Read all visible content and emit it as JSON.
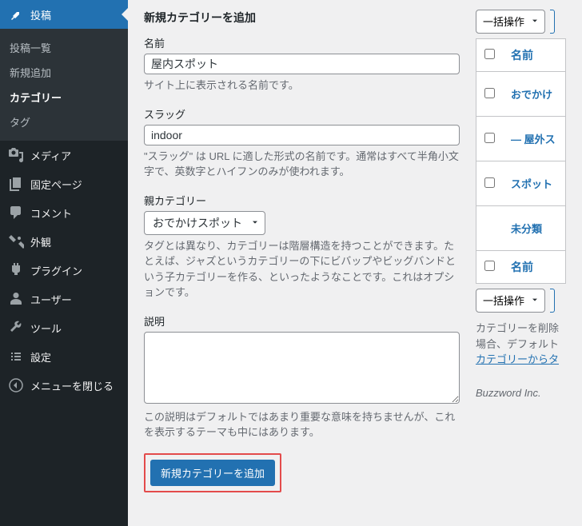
{
  "sidebar": {
    "posts": {
      "label": "投稿"
    },
    "submenu": {
      "all": "投稿一覧",
      "new": "新規追加",
      "category": "カテゴリー",
      "tag": "タグ"
    },
    "media": "メディア",
    "pages": "固定ページ",
    "comments": "コメント",
    "appearance": "外観",
    "plugins": "プラグイン",
    "users": "ユーザー",
    "tools": "ツール",
    "settings": "設定",
    "collapse": "メニューを閉じる"
  },
  "form": {
    "heading": "新規カテゴリーを追加",
    "name": {
      "label": "名前",
      "value": "屋内スポット",
      "help": "サイト上に表示される名前です。"
    },
    "slug": {
      "label": "スラッグ",
      "value": "indoor",
      "help": "\"スラッグ\" は URL に適した形式の名前です。通常はすべて半角小文字で、英数字とハイフンのみが使われます。"
    },
    "parent": {
      "label": "親カテゴリー",
      "value": "おでかけスポット",
      "help": "タグとは異なり、カテゴリーは階層構造を持つことができます。たとえば、ジャズというカテゴリーの下にビバップやビッグバンドという子カテゴリーを作る、といったようなことです。これはオプションです。"
    },
    "desc": {
      "label": "説明",
      "value": "",
      "help": "この説明はデフォルトではあまり重要な意味を持ちませんが、これを表示するテーマも中にはあります。"
    },
    "submit": "新規カテゴリーを追加"
  },
  "table": {
    "bulk_action": "一括操作",
    "column_name": "名前",
    "rows": [
      {
        "name": "おでかけ"
      },
      {
        "name": "— 屋外ス"
      },
      {
        "name": "スポット"
      },
      {
        "name": "未分類"
      }
    ],
    "footnote1": "カテゴリーを削除",
    "footnote2": "場合、デフォルト",
    "footnote_link": "カテゴリーからタ"
  },
  "footer": "Buzzword Inc."
}
